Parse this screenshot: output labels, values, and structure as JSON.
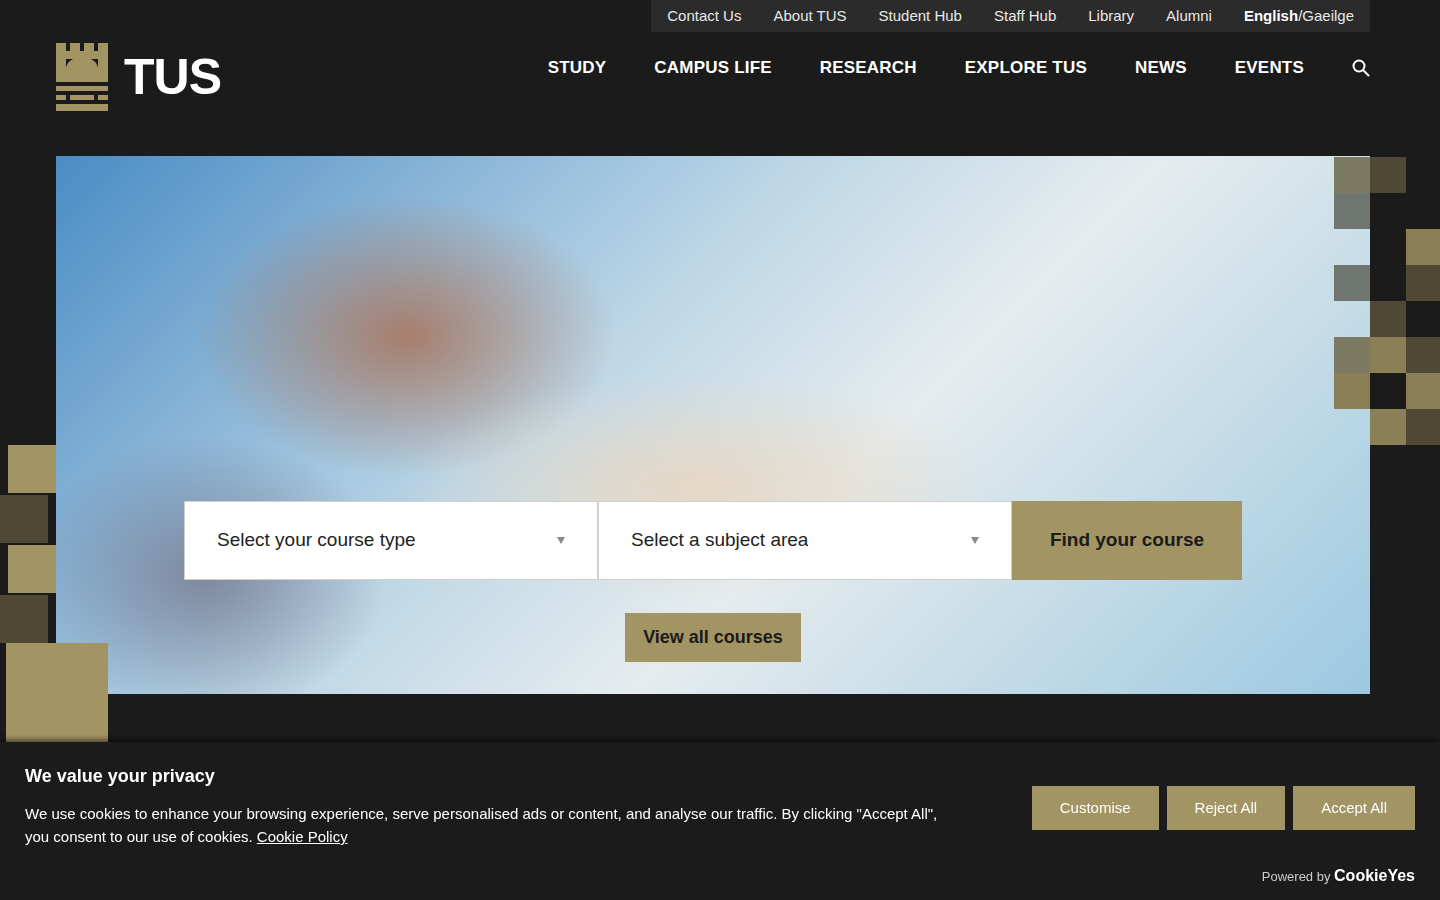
{
  "utility_nav": [
    {
      "label": "Contact Us"
    },
    {
      "label": "About TUS"
    },
    {
      "label": "Student Hub"
    },
    {
      "label": "Staff Hub"
    },
    {
      "label": "Library"
    },
    {
      "label": "Alumni"
    }
  ],
  "language": {
    "items": [
      {
        "label": "English",
        "selected": true
      },
      {
        "label": "Gaeilge",
        "selected": false
      }
    ],
    "separator": "/"
  },
  "logo": {
    "text": "TUS"
  },
  "main_nav": [
    {
      "label": "STUDY"
    },
    {
      "label": "CAMPUS LIFE"
    },
    {
      "label": "RESEARCH"
    },
    {
      "label": "EXPLORE TUS"
    },
    {
      "label": "NEWS"
    },
    {
      "label": "EVENTS"
    }
  ],
  "course_search": {
    "course_type": "Select your course type",
    "subject_area": "Select a subject area",
    "button": "Find your course",
    "view_all": "View all courses"
  },
  "cookie_banner": {
    "title": "We value your privacy",
    "text": "We use cookies to enhance your browsing experience, serve personalised ads or content, and analyse our traffic. By clicking \"Accept All\", you consent to our use of cookies.",
    "link": "Cookie Policy",
    "buttons": [
      "Customise",
      "Reject All",
      "Accept All"
    ],
    "powered_by": "Powered by",
    "brand": "CookieYes"
  }
}
